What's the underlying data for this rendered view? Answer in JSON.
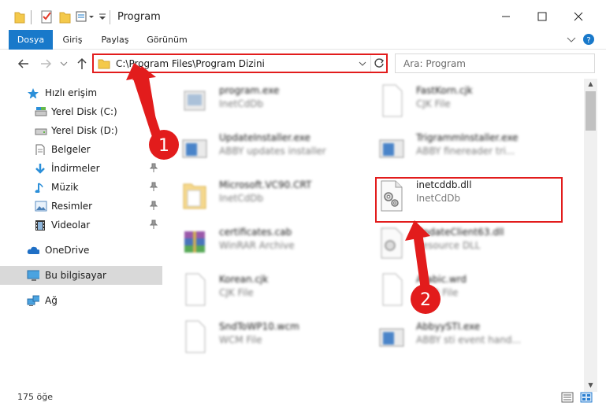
{
  "window": {
    "title": "Program",
    "controls": [
      "minimize",
      "maximize",
      "close"
    ]
  },
  "ribbon": {
    "tabs": [
      {
        "label": "Dosya"
      },
      {
        "label": "Giriş"
      },
      {
        "label": "Paylaş"
      },
      {
        "label": "Görünüm"
      }
    ]
  },
  "address": {
    "path": "C:\\Program Files\\Program Dizini",
    "search_placeholder": "Ara: Program"
  },
  "sidebar": {
    "items": [
      {
        "label": "Hızlı erişim",
        "icon": "star-icon",
        "pinned": false
      },
      {
        "label": "Yerel Disk (C:)",
        "icon": "drive-icon",
        "pinned": false
      },
      {
        "label": "Yerel Disk (D:)",
        "icon": "drive-icon",
        "pinned": true
      },
      {
        "label": "Belgeler",
        "icon": "documents-icon",
        "pinned": true
      },
      {
        "label": "İndirmeler",
        "icon": "download-icon",
        "pinned": true
      },
      {
        "label": "Müzik",
        "icon": "music-icon",
        "pinned": true
      },
      {
        "label": "Resimler",
        "icon": "pictures-icon",
        "pinned": true
      },
      {
        "label": "Videolar",
        "icon": "videos-icon",
        "pinned": true
      },
      {
        "label": "OneDrive",
        "icon": "cloud-icon",
        "pinned": false
      },
      {
        "label": "Bu bilgisayar",
        "icon": "computer-icon",
        "pinned": false,
        "selected": true
      },
      {
        "label": "Ağ",
        "icon": "network-icon",
        "pinned": false
      }
    ]
  },
  "files": [
    {
      "name": "program.exe",
      "sub": "InetCdDb",
      "blurred": true
    },
    {
      "name": "FastKorn.cjk",
      "sub": "CJK File",
      "blurred": true
    },
    {
      "name": "UpdateInstaller.exe",
      "sub": "ABBY updates installer",
      "blurred": true
    },
    {
      "name": "TrigrammInstaller.exe",
      "sub": "ABBY finereader tri...",
      "blurred": true
    },
    {
      "name": "Microsoft.VC90.CRT",
      "sub": "InetCdDb",
      "blurred": true
    },
    {
      "name": "inetcddb.dll",
      "sub": "InetCdDb",
      "blurred": false
    },
    {
      "name": "certificates.cab",
      "sub": "WinRAR Archive",
      "blurred": true
    },
    {
      "name": "UpdateClient63.dll",
      "sub": "Resource DLL",
      "blurred": true
    },
    {
      "name": "Korean.cjk",
      "sub": "CJK File",
      "blurred": true
    },
    {
      "name": "Arabic.wrd",
      "sub": "WRD File",
      "blurred": true
    },
    {
      "name": "SndToWP10.wcm",
      "sub": "WCM File",
      "blurred": true
    },
    {
      "name": "AbbyySTI.exe",
      "sub": "ABBY sti event hand...",
      "blurred": true
    }
  ],
  "status": {
    "item_count": "175 öğe"
  },
  "annotations": {
    "step1": "1",
    "step2": "2",
    "color": "#e21c1c"
  },
  "colors": {
    "accent": "#1979ca",
    "highlight": "#e21c1c",
    "selected_bg": "#d9d9d9"
  }
}
